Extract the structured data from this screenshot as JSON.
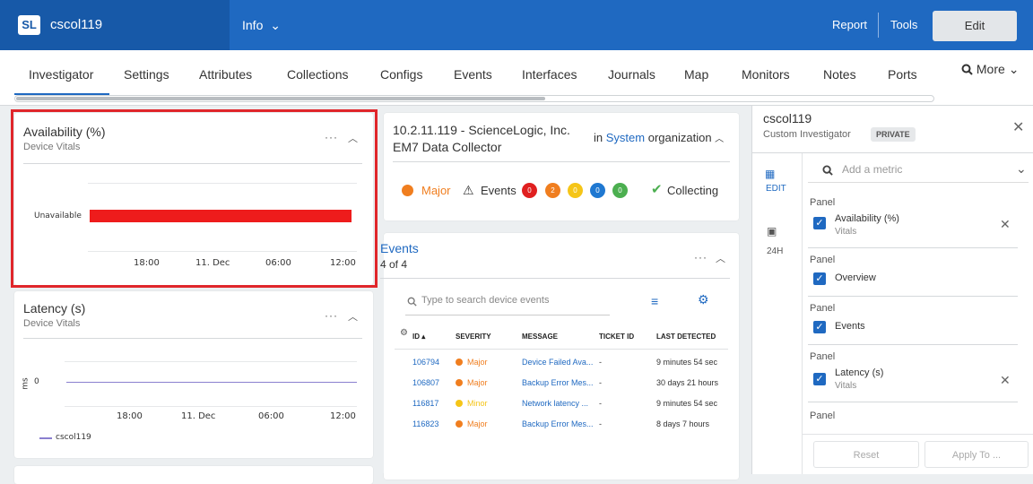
{
  "topbar": {
    "logo": "SL",
    "device_name": "cscol119",
    "info_label": "Info",
    "info_chevron": "⌄",
    "report_label": "Report",
    "tools_label": "Tools",
    "edit_label": "Edit"
  },
  "tabs": [
    "Investigator",
    "Settings",
    "Attributes",
    "Collections",
    "Configs",
    "Events",
    "Interfaces",
    "Journals",
    "Map",
    "Monitors",
    "Notes",
    "Ports"
  ],
  "more_label": "More",
  "availability": {
    "title": "Availability (%)",
    "subtitle": "Device Vitals",
    "row_label": "Unavailable",
    "ticks": [
      "18:00",
      "11. Dec",
      "06:00",
      "12:00"
    ],
    "bar_color": "#ee1c1c"
  },
  "latency": {
    "title": "Latency (s)",
    "subtitle": "Device Vitals",
    "y_unit": "ms",
    "y_value": "0",
    "ticks": [
      "18:00",
      "11. Dec",
      "06:00",
      "12:00"
    ],
    "legend": "cscol119",
    "line_color": "#8a7fcf"
  },
  "device": {
    "title_line1": "10.2.11.119 - ScienceLogic, Inc.",
    "title_line2": "EM7 Data Collector",
    "org_prefix": "in",
    "org_link": "System",
    "org_suffix": "organization",
    "severity": "Major",
    "events_label": "Events",
    "badges": [
      {
        "value": "0",
        "color": "#e02020"
      },
      {
        "value": "2",
        "color": "#f07e1f"
      },
      {
        "value": "0",
        "color": "#f5c518"
      },
      {
        "value": "0",
        "color": "#1f78d1"
      },
      {
        "value": "0",
        "color": "#4caf50"
      }
    ],
    "collecting_label": "Collecting"
  },
  "events": {
    "title": "Events",
    "count": "4 of 4",
    "search_placeholder": "Type to search device events",
    "columns": [
      "ID",
      "SEVERITY",
      "MESSAGE",
      "TICKET ID",
      "LAST DETECTED"
    ],
    "rows": [
      {
        "id": "106794",
        "severity": "Major",
        "sev_color": "#f07e1f",
        "message": "Device Failed Ava...",
        "ticket": "-",
        "last": "9 minutes 54 sec"
      },
      {
        "id": "106807",
        "severity": "Major",
        "sev_color": "#f07e1f",
        "message": "Backup Error Mes...",
        "ticket": "-",
        "last": "30 days 21 hours"
      },
      {
        "id": "116817",
        "severity": "Minor",
        "sev_color": "#f5c518",
        "message": "Network latency ...",
        "ticket": "-",
        "last": "9 minutes 54 sec"
      },
      {
        "id": "116823",
        "severity": "Major",
        "sev_color": "#f07e1f",
        "message": "Backup Error Mes...",
        "ticket": "-",
        "last": "8 days 7 hours"
      }
    ]
  },
  "right_panel": {
    "title": "cscol119",
    "subtitle": "Custom Investigator",
    "private_badge": "PRIVATE",
    "edit_label": "EDIT",
    "period_label": "24H",
    "metric_placeholder": "Add a metric",
    "panels": [
      {
        "label": "Panel",
        "name": "Availability (%)",
        "sub": "Vitals",
        "removable": true
      },
      {
        "label": "Panel",
        "name": "Overview",
        "sub": "",
        "removable": false
      },
      {
        "label": "Panel",
        "name": "Events",
        "sub": "",
        "removable": false
      },
      {
        "label": "Panel",
        "name": "Latency (s)",
        "sub": "Vitals",
        "removable": true
      },
      {
        "label": "Panel",
        "name": "",
        "sub": "",
        "removable": false
      }
    ],
    "reset_label": "Reset",
    "apply_label": "Apply To ..."
  }
}
